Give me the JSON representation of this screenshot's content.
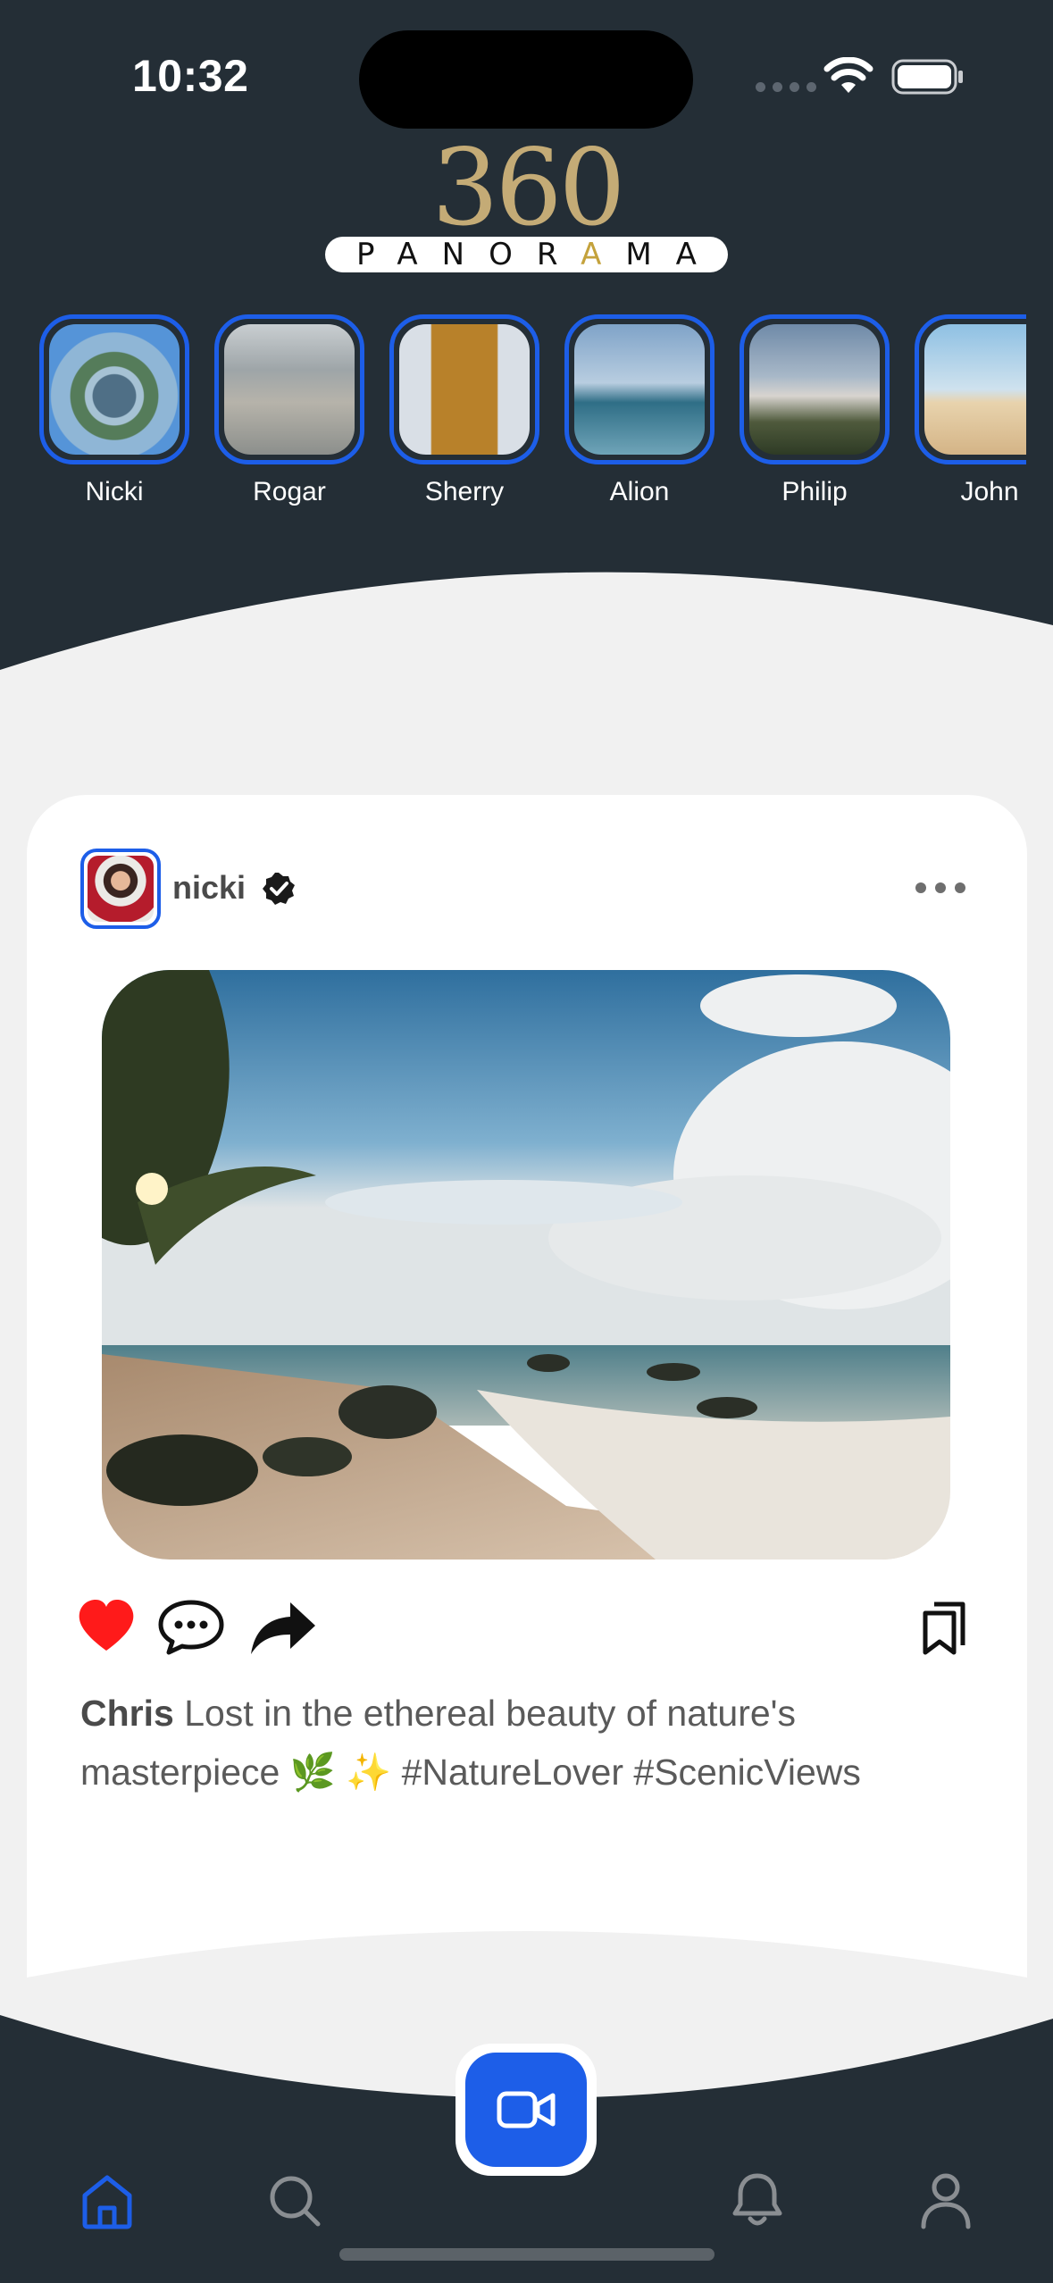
{
  "status_bar": {
    "time": "10:32",
    "icons": [
      "cellular-signal-icon",
      "wifi-icon",
      "battery-icon"
    ]
  },
  "logo": {
    "number": "360",
    "word_before": "PANOR",
    "word_accent": "A",
    "word_after": "MA",
    "colors": {
      "number": "#c4ab76",
      "accent": "#c4a23c"
    }
  },
  "stories": [
    {
      "name": "Nicki"
    },
    {
      "name": "Rogar"
    },
    {
      "name": "Sherry"
    },
    {
      "name": "Alion"
    },
    {
      "name": "Philip"
    },
    {
      "name": "John"
    }
  ],
  "post": {
    "username": "nicki",
    "verified": true,
    "liked": true,
    "caption": {
      "user": "Chris",
      "text": " Lost in the ethereal beauty of nature's masterpiece 🌿 ✨ #NatureLover #ScenicViews"
    },
    "icons": [
      "verified-badge-icon",
      "more-options-icon",
      "heart-icon",
      "comment-icon",
      "share-icon",
      "bookmark-icon"
    ]
  },
  "bottom_nav": {
    "items": [
      {
        "name": "home",
        "icon": "home-icon",
        "active": true
      },
      {
        "name": "search",
        "icon": "search-icon",
        "active": false
      },
      {
        "name": "record",
        "icon": "video-camera-icon",
        "active": false
      },
      {
        "name": "notifications",
        "icon": "bell-icon",
        "active": false
      },
      {
        "name": "profile",
        "icon": "user-icon",
        "active": false
      }
    ]
  },
  "colors": {
    "background": "#242e36",
    "feed_background": "#f1f1f1",
    "accent": "#1d5ee8",
    "like": "#ff1a1a",
    "text": "#4a4a4a"
  }
}
